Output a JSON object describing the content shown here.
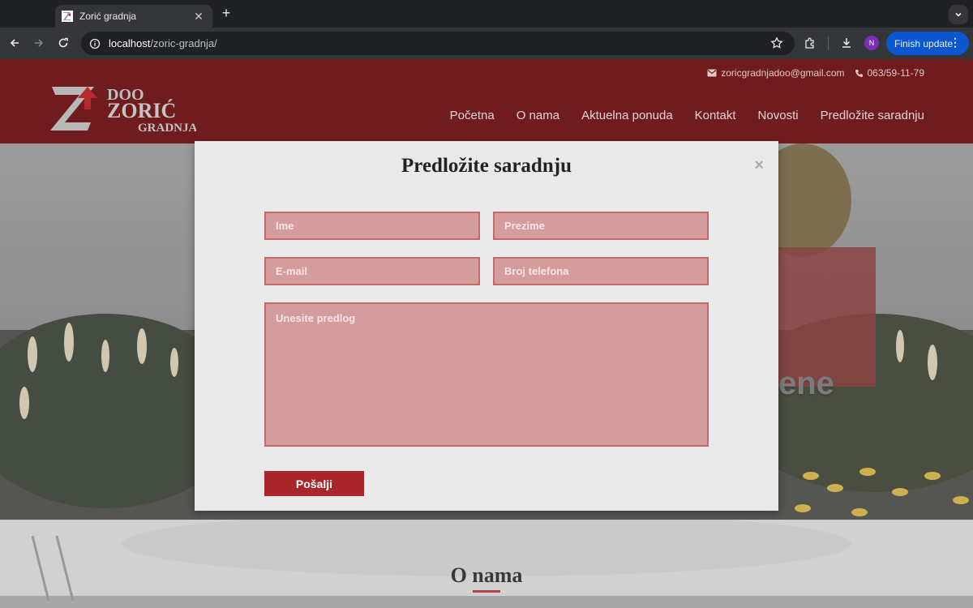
{
  "browser": {
    "tab_title": "Zorić gradnja",
    "url_host": "localhost",
    "url_path": "/zoric-gradnja/",
    "profile_initial": "N",
    "update_label": "Finish update"
  },
  "header": {
    "email": "zoricgradnjadoo@gmail.com",
    "phone": "063/59-11-79",
    "logo_text": [
      "DOO",
      "ZORIĆ",
      "GRADNJA"
    ],
    "nav": [
      "Početna",
      "O nama",
      "Aktuelna ponuda",
      "Kontakt",
      "Novosti",
      "Predložite saradnju"
    ]
  },
  "hero": {
    "partial_text": "ene"
  },
  "modal": {
    "title": "Predložite saradnju",
    "close": "×",
    "first_name_placeholder": "Ime",
    "last_name_placeholder": "Prezime",
    "email_placeholder": "E-mail",
    "phone_placeholder": "Broj telefona",
    "message_placeholder": "Unesite predlog",
    "submit_label": "Pošalji"
  },
  "section": {
    "title": "O nama"
  },
  "colors": {
    "brand": "#701c1f",
    "accent": "#a9272a",
    "field_bg": "#d49c9c"
  }
}
